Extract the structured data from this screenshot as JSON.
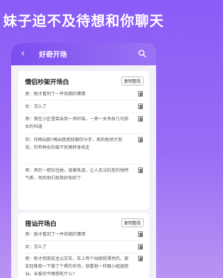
{
  "headline": "妹子迫不及待想和你聊天",
  "navbar": {
    "back_glyph": "‹",
    "title": "好奇开场"
  },
  "cards": [
    {
      "title": "情侣吵架开场白",
      "copy_all_label": "复制整段",
      "lines": [
        "男：刚才看到了一件奇葩的事情",
        "女：怎么了",
        "男：我在小区里目击到一场吵架。一男一女争执几句后女的叫道",
        "你：你再凶我?再凶我我就跟你分手，男的勃然大怒说，你有种女的毫不犹豫转身就走",
        "男：男的一把拉住她，接着吼道，让人无法抗拒的独特气质，然后他们就和好如初了"
      ]
    },
    {
      "title": "搭讪开场白",
      "copy_all_label": "复制整段",
      "lines": [
        "男：刚才看到了一件奇葩的事情",
        "女：怎么了",
        "男：刚才和朋友坐公交车，车上有个姑娘挺漂亮的，朋友轻推我一下做了个嗯的手势，就看他一样跟小姐姐搭讪，亲爱的今晚想吃什么?"
      ]
    }
  ]
}
